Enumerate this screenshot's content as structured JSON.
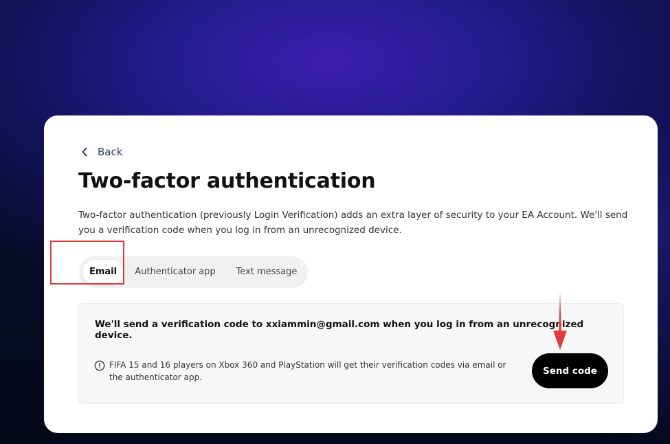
{
  "nav": {
    "back_label": "Back"
  },
  "page": {
    "title": "Two-factor authentication",
    "description": "Two-factor authentication (previously Login Verification) adds an extra layer of security to your EA Account. We'll send you a verification code when you log in from an unrecognized device."
  },
  "tabs": [
    {
      "label": "Email",
      "active": true
    },
    {
      "label": "Authenticator app",
      "active": false
    },
    {
      "label": "Text message",
      "active": false
    }
  ],
  "email_panel": {
    "message": "We'll send a verification code to xxiammin@gmail.com when you log in from an unrecognized device.",
    "note": "FIFA 15 and 16 players on Xbox 360 and PlayStation will get their verification codes via email or the authenticator app.",
    "note_icon": "info-icon",
    "send_button_label": "Send code"
  },
  "annotations": {
    "highlight_color": "#e03b3b",
    "arrow_color": "#e03b3b"
  },
  "colors": {
    "link": "#1f3b72",
    "button_bg": "#000000"
  }
}
